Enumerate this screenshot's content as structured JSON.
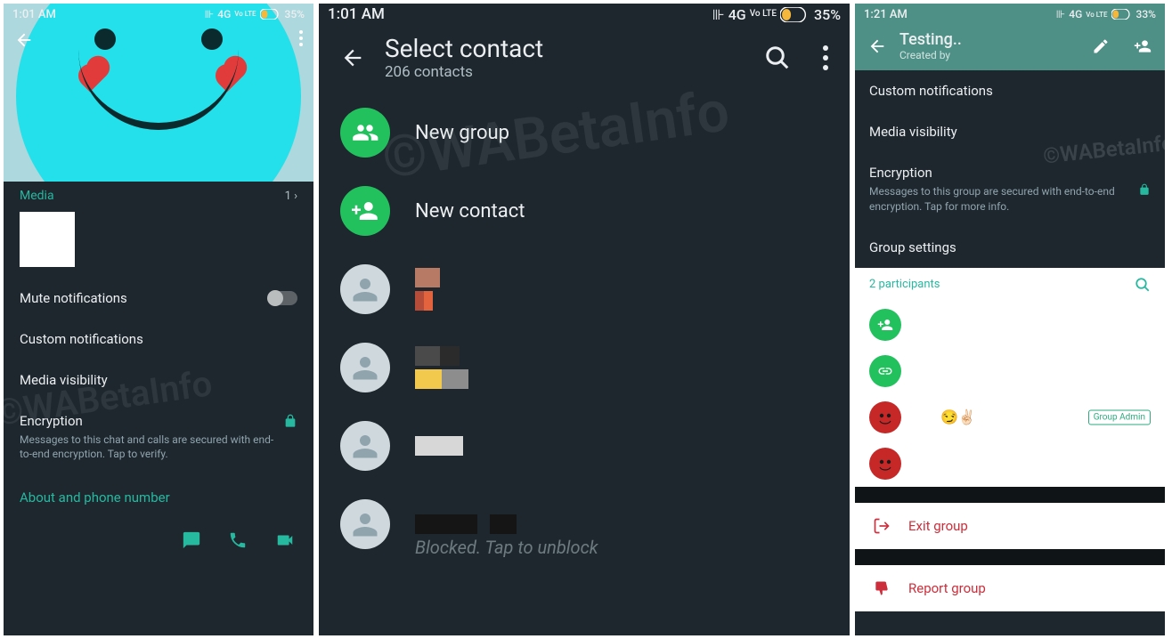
{
  "phone1": {
    "status": {
      "time": "1:01 AM",
      "net": "4G",
      "lte": "Vo LTE",
      "battery": "35%"
    },
    "media": {
      "label": "Media",
      "count": "1 ›"
    },
    "mute": {
      "label": "Mute notifications"
    },
    "custom": {
      "label": "Custom notifications"
    },
    "visibility": {
      "label": "Media visibility"
    },
    "encryption": {
      "label": "Encryption",
      "sub": "Messages to this chat and calls are secured with end-to-end encryption. Tap to verify."
    },
    "about": {
      "label": "About and phone number"
    }
  },
  "phone2": {
    "status": {
      "time": "1:01 AM",
      "net": "4G",
      "lte": "Vo LTE",
      "battery": "35%"
    },
    "title": "Select contact",
    "sub": "206 contacts",
    "newGroup": "New group",
    "newContact": "New contact",
    "blocked": "Blocked. Tap to unblock"
  },
  "phone3": {
    "status": {
      "time": "1:21 AM",
      "net": "4G",
      "lte": "Vo LTE",
      "battery": "33%"
    },
    "title": "Testing..",
    "sub": "Created by",
    "custom": "Custom notifications",
    "visibility": "Media visibility",
    "encryption": {
      "label": "Encryption",
      "sub": "Messages to this group are secured with end-to-end encryption. Tap for more info."
    },
    "groupSettings": "Group settings",
    "participants": "2 participants",
    "emoji": "😏✌🏻",
    "admin": "Group Admin",
    "exit": "Exit group",
    "report": "Report group"
  },
  "watermark": "©WABetaInfo"
}
